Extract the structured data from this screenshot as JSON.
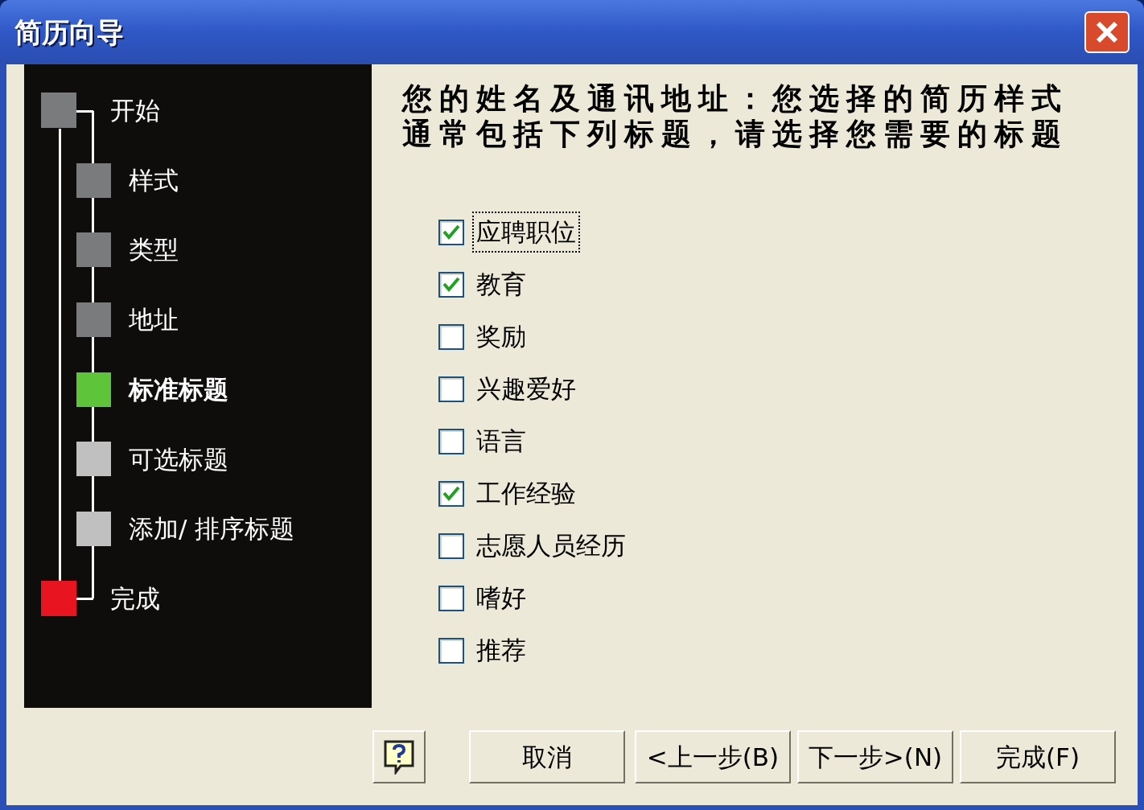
{
  "window": {
    "title": "简历向导"
  },
  "steps": [
    {
      "label": "开始",
      "kind": "main",
      "color": "#7a7b7c",
      "selected": false
    },
    {
      "label": "样式",
      "kind": "sub",
      "color": "#7a7b7c",
      "selected": false
    },
    {
      "label": "类型",
      "kind": "sub",
      "color": "#7a7b7c",
      "selected": false
    },
    {
      "label": "地址",
      "kind": "sub",
      "color": "#7a7b7c",
      "selected": false
    },
    {
      "label": "标准标题",
      "kind": "sub",
      "color": "#5ec43a",
      "selected": true
    },
    {
      "label": "可选标题",
      "kind": "sub",
      "color": "#c0c0c0",
      "selected": false
    },
    {
      "label": "添加/ 排序标题",
      "kind": "sub",
      "color": "#c0c0c0",
      "selected": false
    },
    {
      "label": "完成",
      "kind": "main",
      "color": "#e8141f",
      "selected": false
    }
  ],
  "heading": "您的姓名及通讯地址：您选择的简历样式通常包括下列标题，请选择您需要的标题",
  "options": [
    {
      "label": "应聘职位",
      "checked": true,
      "focused": true
    },
    {
      "label": "教育",
      "checked": true,
      "focused": false
    },
    {
      "label": "奖励",
      "checked": false,
      "focused": false
    },
    {
      "label": "兴趣爱好",
      "checked": false,
      "focused": false
    },
    {
      "label": "语言",
      "checked": false,
      "focused": false
    },
    {
      "label": "工作经验",
      "checked": true,
      "focused": false
    },
    {
      "label": "志愿人员经历",
      "checked": false,
      "focused": false
    },
    {
      "label": "嗜好",
      "checked": false,
      "focused": false
    },
    {
      "label": "推荐",
      "checked": false,
      "focused": false
    }
  ],
  "buttons": [
    "取消",
    "<上一步(B)",
    "下一步>(N)",
    "完成(F)"
  ]
}
